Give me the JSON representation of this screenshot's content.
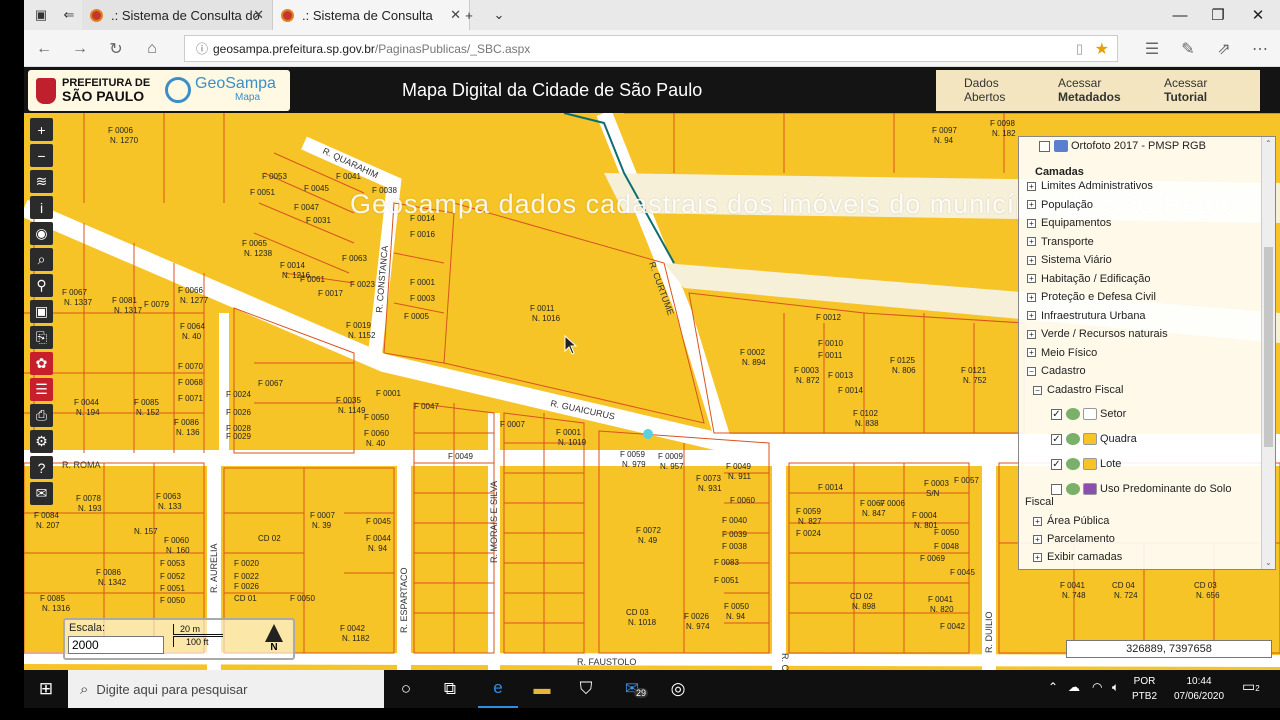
{
  "browser": {
    "tabs": [
      {
        "label": ".: Sistema de Consulta do"
      },
      {
        "label": ".: Sistema de Consulta"
      }
    ],
    "url_host": "geosampa.prefeitura.sp.gov.br",
    "url_path": "/PaginasPublicas/_SBC.aspx"
  },
  "site": {
    "pref_line1": "PREFEITURA DE",
    "pref_line2": "SÃO PAULO",
    "geo_name": "GeoSampa",
    "geo_sub": "Mapa",
    "title": "Mapa Digital da Cidade de São Paulo",
    "buttons": [
      {
        "line1": "Dados",
        "line2": "Abertos"
      },
      {
        "line1": "Acessar",
        "line2": "Metadados"
      },
      {
        "line1": "Acessar",
        "line2": "Tutorial"
      }
    ]
  },
  "map": {
    "watermark": "Geosampa dados cadastrais dos imóveis do município de São Paulo",
    "streets": [
      "R. QUARAHIM",
      "R. CONSTANCA",
      "R. CURTUME",
      "R. GUAICURUS",
      "R. ROMA",
      "R. AURELIA",
      "R. MORAIS E SILVA",
      "R. ESPARTACO",
      "R. CAIO GRA",
      "R. DUILIO",
      "R. FAUSTOLO"
    ],
    "lots": [
      {
        "f": "F 0006",
        "n": "N. 1270"
      },
      {
        "f": "F 0053",
        "n": ""
      },
      {
        "f": "F 0051",
        "n": ""
      },
      {
        "f": "F 0045",
        "n": ""
      },
      {
        "f": "F 0041",
        "n": ""
      },
      {
        "f": "F 0038",
        "n": ""
      },
      {
        "f": "F 0047",
        "n": ""
      },
      {
        "f": "F 0031",
        "n": ""
      },
      {
        "f": "F 0014",
        "n": ""
      },
      {
        "f": "F 0016",
        "n": ""
      },
      {
        "f": "F 0065",
        "n": "N. 1238"
      },
      {
        "f": "F 0014",
        "n": "N. 1216"
      },
      {
        "f": "F 0061",
        "n": ""
      },
      {
        "f": "F 0017",
        "n": ""
      },
      {
        "f": "F 0063",
        "n": ""
      },
      {
        "f": "F 0023",
        "n": ""
      },
      {
        "f": "F 0001",
        "n": ""
      },
      {
        "f": "F 0003",
        "n": ""
      },
      {
        "f": "F 0005",
        "n": ""
      },
      {
        "f": "F 0019",
        "n": "N. 1152"
      },
      {
        "f": "F 0011",
        "n": "N. 1016"
      },
      {
        "f": "F 0067",
        "n": "N. 1337"
      },
      {
        "f": "F 0081",
        "n": "N. 1317"
      },
      {
        "f": "F 0079",
        "n": ""
      },
      {
        "f": "F 0066",
        "n": "N. 1277"
      },
      {
        "f": "F 0064",
        "n": "N. 40"
      },
      {
        "f": "F 0070",
        "n": ""
      },
      {
        "f": "F 0068",
        "n": ""
      },
      {
        "f": "F 0071",
        "n": ""
      },
      {
        "f": "F 0044",
        "n": "N. 194"
      },
      {
        "f": "F 0085",
        "n": "N. 152"
      },
      {
        "f": "F 0086",
        "n": "N. 136"
      },
      {
        "f": "F 0024",
        "n": ""
      },
      {
        "f": "F 0026",
        "n": ""
      },
      {
        "f": "F 0028",
        "n": ""
      },
      {
        "f": "F 0029",
        "n": ""
      },
      {
        "f": "F 0067",
        "n": ""
      },
      {
        "f": "F 0035",
        "n": "N. 1149"
      },
      {
        "f": "F 0050",
        "n": ""
      },
      {
        "f": "F 0060",
        "n": "N. 40"
      },
      {
        "f": "F 0001",
        "n": ""
      },
      {
        "f": "F 0047",
        "n": ""
      },
      {
        "f": "F 0007",
        "n": ""
      },
      {
        "f": "F 0001",
        "n": "N. 1019"
      },
      {
        "f": "F 0049",
        "n": ""
      },
      {
        "f": "F 0002",
        "n": "N. 894"
      },
      {
        "f": "F 0012",
        "n": ""
      },
      {
        "f": "F 0010",
        "n": ""
      },
      {
        "f": "F 0011",
        "n": ""
      },
      {
        "f": "F 0003",
        "n": "N. 872"
      },
      {
        "f": "F 0013",
        "n": ""
      },
      {
        "f": "F 0014",
        "n": ""
      },
      {
        "f": "F 0125",
        "n": "N. 806"
      },
      {
        "f": "F 0102",
        "n": "N. 838"
      },
      {
        "f": "F 0121",
        "n": "N. 752"
      },
      {
        "f": "F 0097",
        "n": "N. 94"
      },
      {
        "f": "F 0098",
        "n": "N. 182"
      },
      {
        "f": "F 0059",
        "n": "N. 979"
      },
      {
        "f": "F 0009",
        "n": "N. 957"
      },
      {
        "f": "F 0073",
        "n": "N. 931"
      },
      {
        "f": "F 0049",
        "n": "N. 911"
      },
      {
        "f": "F 0060",
        "n": ""
      },
      {
        "f": "F 0040",
        "n": ""
      },
      {
        "f": "F 0039",
        "n": ""
      },
      {
        "f": "F 0038",
        "n": ""
      },
      {
        "f": "F 0072",
        "n": "N. 49"
      },
      {
        "f": "F 0083",
        "n": ""
      },
      {
        "f": "F 0051",
        "n": ""
      },
      {
        "f": "F 0014",
        "n": ""
      },
      {
        "f": "F 0067",
        "n": "N. 847"
      },
      {
        "f": "F 0006",
        "n": ""
      },
      {
        "f": "F 0004",
        "n": "N. 801"
      },
      {
        "f": "F 0059",
        "n": "N. 827"
      },
      {
        "f": "F 0024",
        "n": ""
      },
      {
        "f": "F 0050",
        "n": ""
      },
      {
        "f": "F 0048",
        "n": ""
      },
      {
        "f": "F 0069",
        "n": ""
      },
      {
        "f": "F 0003",
        "n": "S/N"
      },
      {
        "f": "F 0057",
        "n": ""
      },
      {
        "f": "F 0045",
        "n": ""
      },
      {
        "f": "F 0063",
        "n": "N. 133"
      },
      {
        "f": "F 0078",
        "n": "N. 193"
      },
      {
        "f": "F 0084",
        "n": "N. 207"
      },
      {
        "f": "N. 157",
        "n": ""
      },
      {
        "f": "F 0060",
        "n": "N. 160"
      },
      {
        "f": "F 0053",
        "n": ""
      },
      {
        "f": "F 0052",
        "n": ""
      },
      {
        "f": "F 0051",
        "n": ""
      },
      {
        "f": "F 0050",
        "n": ""
      },
      {
        "f": "F 0086",
        "n": "N. 1342"
      },
      {
        "f": "F 0085",
        "n": "N. 1316"
      },
      {
        "f": "F 0007",
        "n": "N. 39"
      },
      {
        "f": "F 0045",
        "n": ""
      },
      {
        "f": "F 0044",
        "n": "N. 94"
      },
      {
        "f": "CD 02",
        "n": ""
      },
      {
        "f": "F 0020",
        "n": ""
      },
      {
        "f": "F 0022",
        "n": ""
      },
      {
        "f": "F 0026",
        "n": ""
      },
      {
        "f": "CD 01",
        "n": ""
      },
      {
        "f": "F 0050",
        "n": ""
      },
      {
        "f": "F 0042",
        "n": "N. 1182"
      },
      {
        "f": "CD 03",
        "n": "N. 1018"
      },
      {
        "f": "F 0026",
        "n": "N. 974"
      },
      {
        "f": "F 0050",
        "n": "N. 94"
      },
      {
        "f": "CD 02",
        "n": "N. 898"
      },
      {
        "f": "F 0041",
        "n": "N. 820"
      },
      {
        "f": "F 0042",
        "n": ""
      },
      {
        "f": "F 0041",
        "n": "N. 748"
      },
      {
        "f": "CD 04",
        "n": "N. 724"
      },
      {
        "f": "CD 03",
        "n": "N. 656"
      }
    ]
  },
  "layers": {
    "ortofoto": "Ortofoto 2017 - PMSP RGB",
    "heading": "Camadas",
    "groups": [
      "Limites Administrativos",
      "População",
      "Equipamentos",
      "Transporte",
      "Sistema Viário",
      "Habitação / Edificação",
      "Proteção e Defesa Civil",
      "Infraestrutura Urbana",
      "Verde / Recursos naturais",
      "Meio Físico",
      "Cadastro"
    ],
    "cadastro_fiscal": "Cadastro Fiscal",
    "fiscal_items": [
      {
        "label": "Setor",
        "checked": true
      },
      {
        "label": "Quadra",
        "checked": true
      },
      {
        "label": "Lote",
        "checked": true
      },
      {
        "label": "Uso Predominante do Solo",
        "checked": false
      }
    ],
    "fiscal_suffix": "Fiscal",
    "tail": [
      "Área Pública",
      "Parcelamento",
      "Exibir camadas"
    ]
  },
  "scale": {
    "label": "Escala:",
    "value": "2000",
    "bar_m": "20 m",
    "bar_ft": "100 ft",
    "north": "N"
  },
  "coords": "326889, 7397658",
  "taskbar": {
    "search_placeholder": "Digite aqui para pesquisar",
    "mail_badge": "29",
    "lang1": "POR",
    "lang2": "PTB2",
    "time": "10:44",
    "date": "07/06/2020",
    "notif": "2"
  },
  "colors": {
    "map_fill": "#f6c427",
    "parcel_line": "#d9531e",
    "street": "#ffffff",
    "highway": "#f6f0d8"
  }
}
